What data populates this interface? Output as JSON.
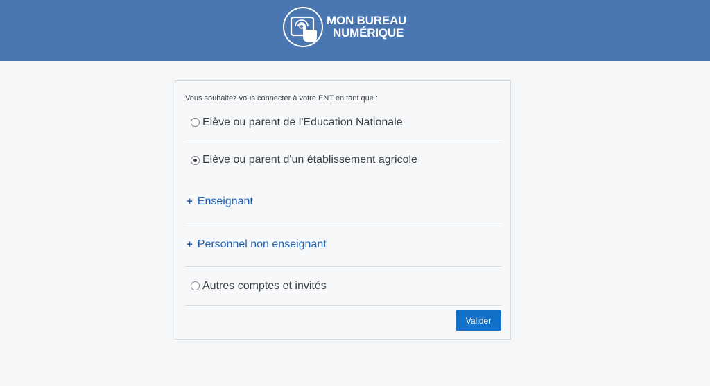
{
  "header": {
    "logo_line1": "MON BUREAU",
    "logo_line2": "NUMÉRIQUE",
    "logo_icon": "tablet-touch-icon"
  },
  "form": {
    "intro": "Vous souhaitez vous connecter à votre ENT en tant que :",
    "options": [
      {
        "type": "radio",
        "label": "Elève ou parent de l'Education Nationale",
        "checked": false
      },
      {
        "type": "radio",
        "label": "Elève ou parent d'un établissement agricole",
        "checked": true
      },
      {
        "type": "expand",
        "label": "Enseignant",
        "icon": "plus-icon"
      },
      {
        "type": "expand",
        "label": "Personnel non enseignant",
        "icon": "plus-icon"
      },
      {
        "type": "radio",
        "label": "Autres comptes et invités",
        "checked": false
      }
    ],
    "submit_label": "Valider"
  },
  "colors": {
    "header_bg": "#4a76b2",
    "link": "#1f63b5",
    "button": "#1371c8"
  }
}
